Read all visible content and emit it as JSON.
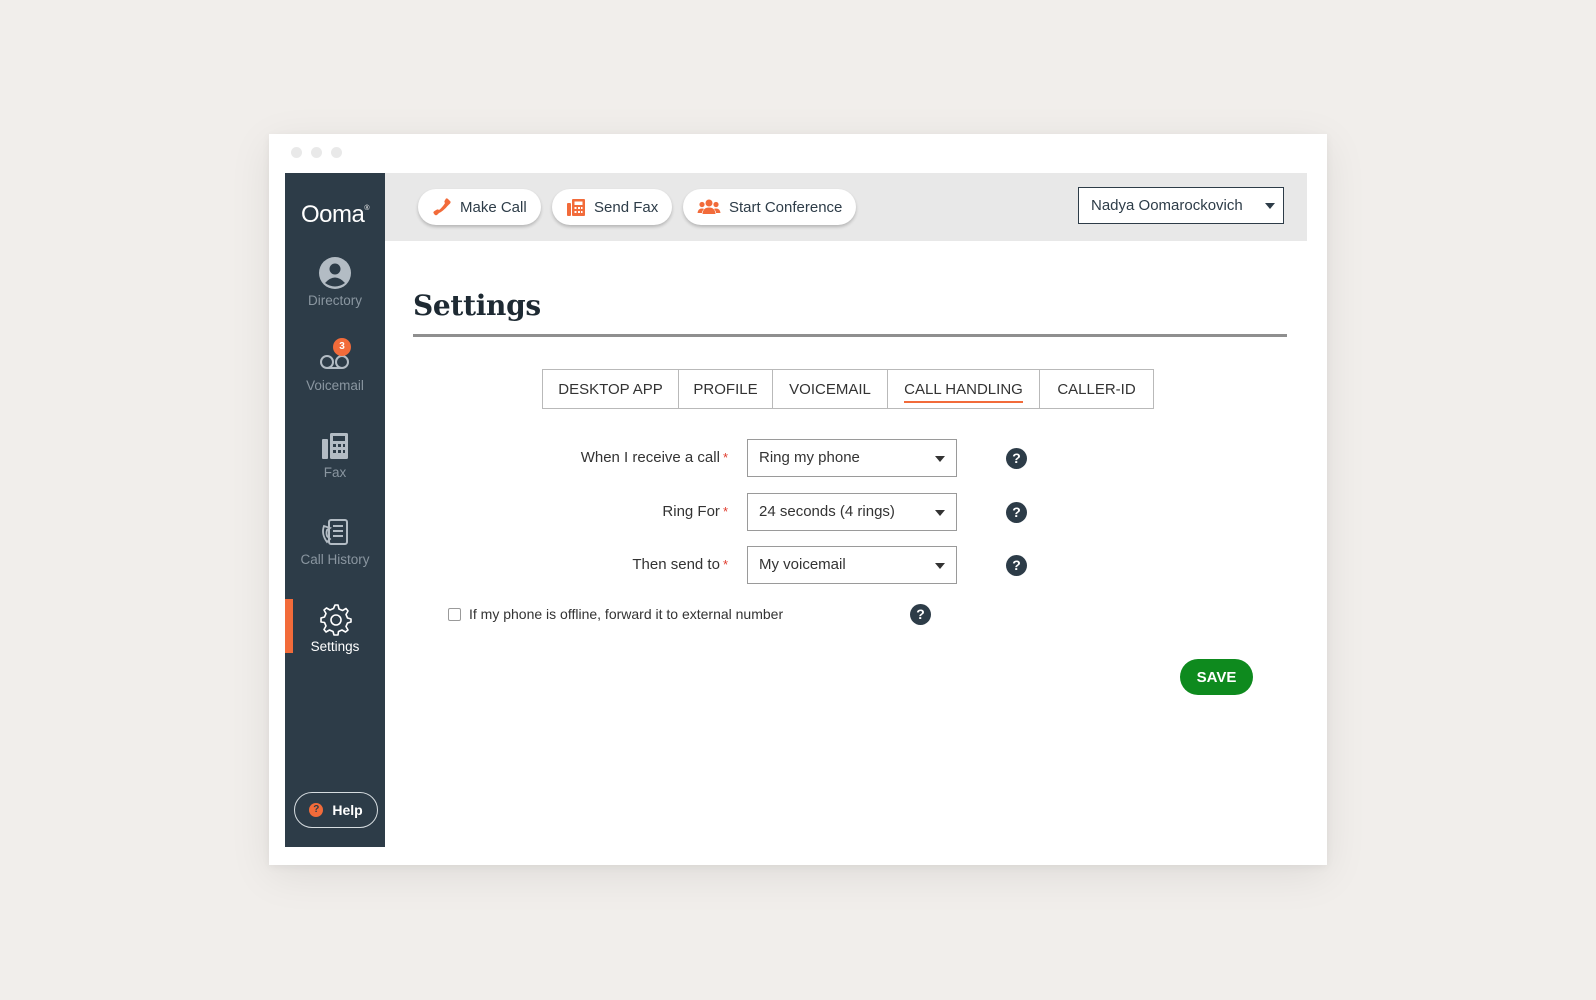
{
  "sidebar": {
    "logo": "Ooma",
    "logo_mark": "®",
    "items": [
      {
        "label": "Directory"
      },
      {
        "label": "Voicemail",
        "badge": "3"
      },
      {
        "label": "Fax"
      },
      {
        "label": "Call History"
      },
      {
        "label": "Settings",
        "active": true
      }
    ],
    "help_label": "Help"
  },
  "topbar": {
    "make_call": "Make Call",
    "send_fax": "Send Fax",
    "start_conference": "Start Conference",
    "user_name": "Nadya Oomarockovich"
  },
  "page": {
    "title": "Settings",
    "tabs": [
      {
        "label": "DESKTOP APP"
      },
      {
        "label": "PROFILE"
      },
      {
        "label": "VOICEMAIL"
      },
      {
        "label": "CALL HANDLING",
        "active": true
      },
      {
        "label": "CALLER-ID"
      }
    ]
  },
  "form": {
    "receive_label": "When I receive a call",
    "receive_value": "Ring my phone",
    "ring_for_label": "Ring For",
    "ring_for_value": "24 seconds (4 rings)",
    "then_send_label": "Then send to",
    "then_send_value": "My voicemail",
    "required_mark": "*",
    "offline_forward_label": "If my phone is offline, forward it to external number",
    "offline_forward_checked": false,
    "help_glyph": "?",
    "save_label": "SAVE"
  },
  "colors": {
    "sidebar_bg": "#2d3c48",
    "accent_orange": "#f26b3a",
    "save_green": "#0e8a1e",
    "topbar_bg": "#e8e8e8"
  }
}
